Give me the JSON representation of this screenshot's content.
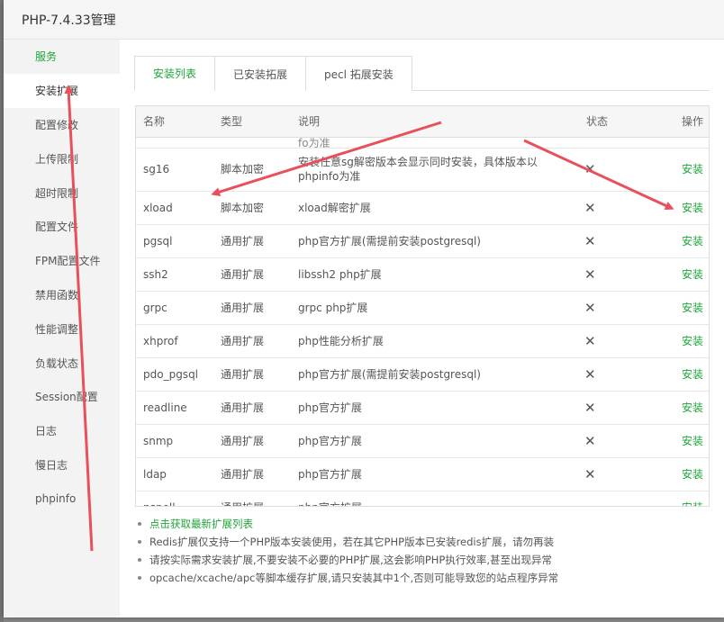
{
  "window": {
    "title": "PHP-7.4.33管理"
  },
  "sidebar": {
    "items": [
      {
        "label": "服务"
      },
      {
        "label": "安装扩展"
      },
      {
        "label": "配置修改"
      },
      {
        "label": "上传限制"
      },
      {
        "label": "超时限制"
      },
      {
        "label": "配置文件"
      },
      {
        "label": "FPM配置文件"
      },
      {
        "label": "禁用函数"
      },
      {
        "label": "性能调整"
      },
      {
        "label": "负载状态"
      },
      {
        "label": "Session配置"
      },
      {
        "label": "日志"
      },
      {
        "label": "慢日志"
      },
      {
        "label": "phpinfo"
      }
    ]
  },
  "tabs": [
    {
      "label": "安装列表"
    },
    {
      "label": "已安装拓展"
    },
    {
      "label": "pecl 拓展安装"
    }
  ],
  "table": {
    "headers": {
      "name": "名称",
      "type": "类型",
      "desc": "说明",
      "status": "状态",
      "op": "操作"
    },
    "cut_top_desc": "fo为准",
    "rows": [
      {
        "name": "sg16",
        "type": "脚本加密",
        "desc": "安装任意sg解密版本会显示同时安装，具体版本以phpinfo为准",
        "status": "✕",
        "op": "安装"
      },
      {
        "name": "xload",
        "type": "脚本加密",
        "desc": "xload解密扩展",
        "status": "✕",
        "op": "安装"
      },
      {
        "name": "pgsql",
        "type": "通用扩展",
        "desc": "php官方扩展(需提前安装postgresql)",
        "status": "✕",
        "op": "安装"
      },
      {
        "name": "ssh2",
        "type": "通用扩展",
        "desc": "libssh2 php扩展",
        "status": "✕",
        "op": "安装"
      },
      {
        "name": "grpc",
        "type": "通用扩展",
        "desc": "grpc php扩展",
        "status": "✕",
        "op": "安装"
      },
      {
        "name": "xhprof",
        "type": "通用扩展",
        "desc": "php性能分析扩展",
        "status": "✕",
        "op": "安装"
      },
      {
        "name": "pdo_pgsql",
        "type": "通用扩展",
        "desc": "php官方扩展(需提前安装postgresql)",
        "status": "✕",
        "op": "安装"
      },
      {
        "name": "readline",
        "type": "通用扩展",
        "desc": "php官方扩展",
        "status": "✕",
        "op": "安装"
      },
      {
        "name": "snmp",
        "type": "通用扩展",
        "desc": "php官方扩展",
        "status": "✕",
        "op": "安装"
      },
      {
        "name": "ldap",
        "type": "通用扩展",
        "desc": "php官方扩展",
        "status": "✕",
        "op": "安装"
      },
      {
        "name": "pspell",
        "type": "通用扩展",
        "desc": "php官方扩展",
        "status": "",
        "op": "安装"
      }
    ]
  },
  "tips": [
    {
      "text": "点击获取最新扩展列表"
    },
    {
      "text": "Redis扩展仅支持一个PHP版本安装使用，若在其它PHP版本已安装redis扩展，请勿再装"
    },
    {
      "text": "请按实际需求安装扩展,不要安装不必要的PHP扩展,这会影响PHP执行效率,甚至出现异常"
    },
    {
      "text": "opcache/xcache/apc等脚本缓存扩展,请只安装其中1个,否则可能导致您的站点程序异常"
    }
  ],
  "colors": {
    "accent": "#20a53a",
    "annotation_arrow": "#e8505b"
  }
}
